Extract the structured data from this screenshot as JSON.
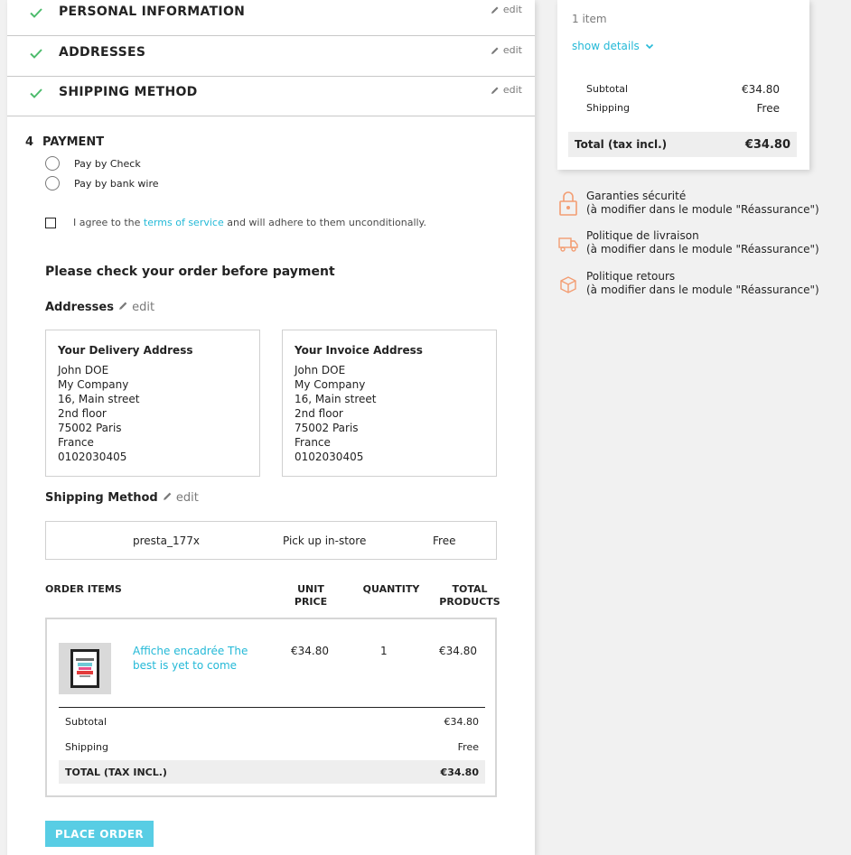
{
  "steps": {
    "personal": {
      "title": "PERSONAL INFORMATION",
      "edit": "edit"
    },
    "addresses": {
      "title": "ADDRESSES",
      "edit": "edit"
    },
    "shipping": {
      "title": "SHIPPING METHOD",
      "edit": "edit"
    }
  },
  "payment": {
    "number": "4",
    "title": "PAYMENT",
    "options": [
      "Pay by Check",
      "Pay by bank wire"
    ],
    "agree_prefix": "I agree to the",
    "agree_link": "terms of service",
    "agree_suffix": "and will adhere to them unconditionally."
  },
  "review": {
    "heading": "Please check your order before payment",
    "addresses_label": "Addresses",
    "edit": "edit",
    "delivery": {
      "title": "Your Delivery Address",
      "lines": [
        "John DOE",
        "My Company",
        "16, Main street",
        "2nd floor",
        "75002 Paris",
        "France",
        "0102030405"
      ]
    },
    "invoice": {
      "title": "Your Invoice Address",
      "lines": [
        "John DOE",
        "My Company",
        "16, Main street",
        "2nd floor",
        "75002 Paris",
        "France",
        "0102030405"
      ]
    },
    "shipping_label": "Shipping Method",
    "carrier": "presta_177x",
    "carrier_delay": "Pick up in-store",
    "carrier_price": "Free"
  },
  "items": {
    "headers": {
      "name": "ORDER ITEMS",
      "unit1": "UNIT",
      "unit2": "PRICE",
      "qty": "QUANTITY",
      "total1": "TOTAL",
      "total2": "PRODUCTS"
    },
    "product": {
      "name": "Affiche encadrée The best is yet to come",
      "unit_price": "€34.80",
      "quantity": "1",
      "total": "€34.80"
    },
    "subtotal_label": "Subtotal",
    "subtotal": "€34.80",
    "shipping_label": "Shipping",
    "shipping": "Free",
    "total_label": "TOTAL (TAX INCL.)",
    "total": "€34.80"
  },
  "place_order": "PLACE ORDER",
  "cart": {
    "count": "1 item",
    "show_details": "show details",
    "subtotal_label": "Subtotal",
    "subtotal": "€34.80",
    "shipping_label": "Shipping",
    "shipping": "Free",
    "total_label": "Total (tax incl.)",
    "total": "€34.80"
  },
  "reassurance": [
    {
      "title": "Garanties sécurité",
      "text": "(à modifier dans le module \"Réassurance\")",
      "icon": "lock-icon"
    },
    {
      "title": "Politique de livraison",
      "text": "(à modifier dans le module \"Réassurance\")",
      "icon": "truck-icon"
    },
    {
      "title": "Politique retours",
      "text": "(à modifier dans le module \"Réassurance\")",
      "icon": "return-box-icon"
    }
  ],
  "colors": {
    "accent": "#24b9d7",
    "check": "#4cbb6c",
    "button": "#2fc1de",
    "reassurance_icon": "#f39d72"
  }
}
